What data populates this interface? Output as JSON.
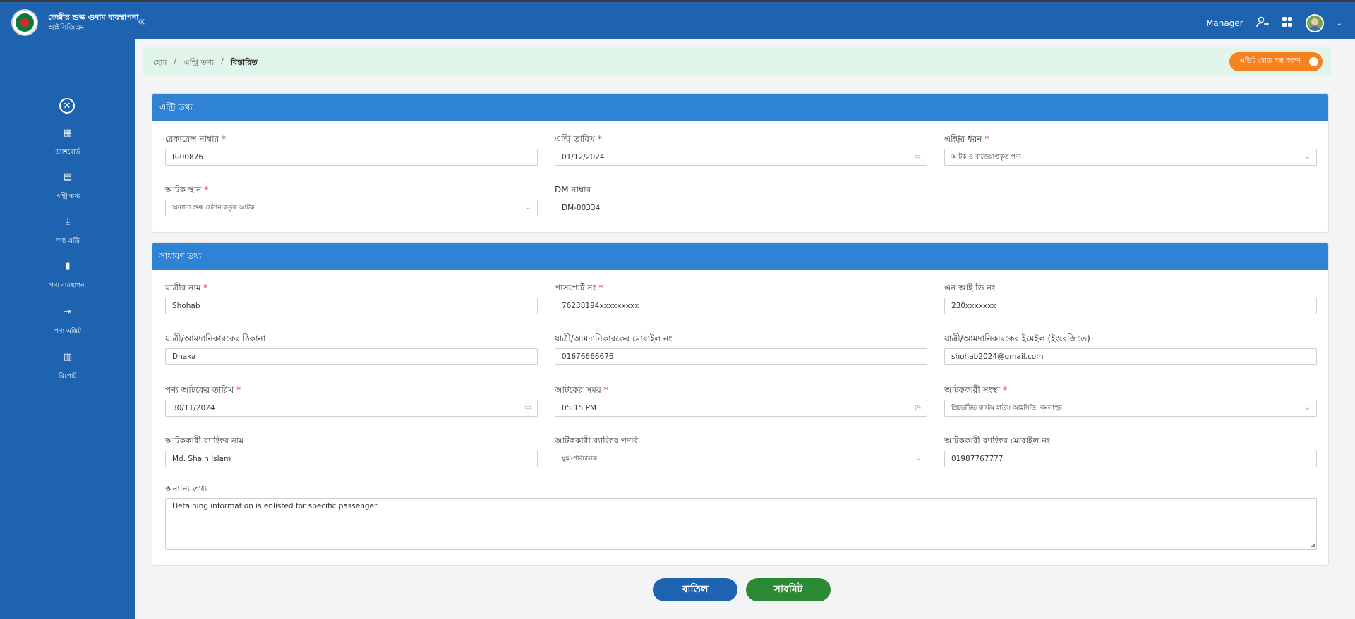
{
  "header": {
    "app_title": "কেন্দ্রীয় শুল্ক গুদাম ব্যবস্থাপনা",
    "app_subtitle": "আইসিজিএম",
    "collapse_icon": "chevrons-left-icon",
    "user_link": "Manager",
    "user_icon": "user-switch-icon",
    "apps_icon": "grid-icon",
    "avatar": "avatar",
    "caret": "⌄"
  },
  "sidebar": {
    "close_glyph": "✕",
    "items": [
      {
        "icon": "dashboard-icon",
        "glyph": "▦",
        "label": "ড্যাশবোর্ড"
      },
      {
        "icon": "document-icon",
        "glyph": "▤",
        "label": "এন্ট্রি তথ্য"
      },
      {
        "icon": "download-icon",
        "glyph": "⤓",
        "label": "পণ্য এন্ট্রি"
      },
      {
        "icon": "book-icon",
        "glyph": "▮",
        "label": "পণ্য ব্যবস্থাপনা"
      },
      {
        "icon": "exit-icon",
        "glyph": "⇥",
        "label": "পণ্য এক্সিট"
      },
      {
        "icon": "file-report-icon",
        "glyph": "▥",
        "label": "রিপোর্ট"
      }
    ]
  },
  "breadcrumb": {
    "home": "হোম",
    "sep": "/",
    "section": "এন্ট্রি তথ্য",
    "current": "বিস্তারিত"
  },
  "edit_toggle": {
    "label": "এডিট মোড বন্ধ করুন",
    "state": "on",
    "color": "#f5821f"
  },
  "entry_info": {
    "title": "এন্ট্রি তথ্য",
    "reference": {
      "label": "রেফারেন্স নাম্বার",
      "value": "R-00876"
    },
    "entry_date": {
      "label": "এন্ট্রি তারিখ",
      "value": "01/12/2024"
    },
    "entry_type": {
      "label": "এন্ট্রির ধরন",
      "value": "আটক ও বাজেয়াপ্তকৃত পণ্য"
    },
    "seize_place": {
      "label": "আটক স্থান",
      "value": "অন্যান্য শুল্ক স্টেশন কর্তৃক আটক"
    },
    "dm_number": {
      "label": "DM নাম্বার",
      "value": "DM-00334"
    }
  },
  "general_info": {
    "title": "সাধারণ তথ্য",
    "passenger_name": {
      "label": "যাত্রীর নাম",
      "value": "Shohab"
    },
    "passport": {
      "label": "পাসপোর্ট নং",
      "value": "76238194xxxxxxxxx"
    },
    "nid": {
      "label": "এন আই ডি নং",
      "value": "230xxxxxxx"
    },
    "address": {
      "label": "যাত্রী/আমদানিকারকের ঠিকানা",
      "value": "Dhaka"
    },
    "mobile": {
      "label": "যাত্রী/আমদানিকারকের মোবাইল নং",
      "value": "01676666676"
    },
    "email": {
      "label": "যাত্রী/আমদানিকারকের ইমেইল (ইংরেজিতে)",
      "value": "shohab2024@gmail.com"
    },
    "seize_date": {
      "label": "পণ্য আটকের তারিখ",
      "value": "30/11/2024"
    },
    "seize_time": {
      "label": "আটকের সময়",
      "value": "05:15 PM"
    },
    "seize_org": {
      "label": "আটককারী সংস্থা",
      "value": "প্রিভেন্টিভ কাস্টম হাউস আইসিডি, কমলাপুর"
    },
    "officer_name": {
      "label": "আটককারী ব্যাক্তির নাম",
      "value": "Md. Shain Islam"
    },
    "officer_post": {
      "label": "আটককারী ব্যাক্তির পদবি",
      "value": "যুগ্ম-পরিচালক"
    },
    "officer_mobile": {
      "label": "আটককারী ব্যাক্তির মোবাইল নং",
      "value": "01987767777"
    },
    "other_info": {
      "label": "অন্যান্য তথ্য",
      "value": "Detaining information is enlisted for specific passenger"
    }
  },
  "required_mark": "*",
  "icons": {
    "calendar": "▭",
    "clock": "◷",
    "chevron": "⌄",
    "resize": "◢"
  },
  "actions": {
    "cancel": "বাতিল",
    "submit": "সাবমিট"
  },
  "colors": {
    "primary": "#1e63b0",
    "section_header": "#2f83d5",
    "submit": "#2a8a34",
    "required": "#d9232e"
  }
}
